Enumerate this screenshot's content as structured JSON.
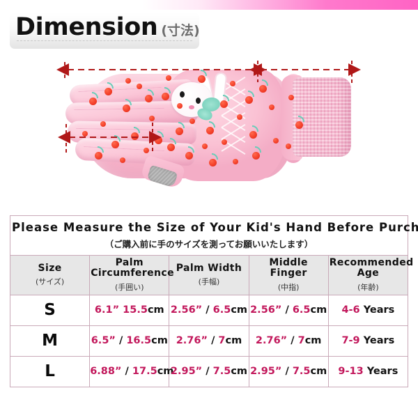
{
  "header": {
    "title_main": "Dimension",
    "title_sub": "(寸法)"
  },
  "photo": {
    "product_alt": "pink kids winter glove with cherry print and bunny applique",
    "measurements": [
      {
        "name": "palm-circumference-arrow",
        "label": ""
      },
      {
        "name": "cuff-length-arrow",
        "label": ""
      },
      {
        "name": "palm-width-arrow",
        "label": ""
      }
    ],
    "colors": {
      "glove_pink": "#fbc7d8",
      "cherry_red": "#f4402a",
      "stem_mint": "#67cdb8",
      "arrow_red": "#b01818",
      "thumb_gray": "#b3b3b3"
    }
  },
  "table": {
    "title_en": "Please Measure the Size of Your Kid's Hand Before Purchase",
    "title_jp": "（ご購入前に手のサイズを測ってお願いいたします）",
    "columns": [
      {
        "en": "Size",
        "jp": "(サイズ)"
      },
      {
        "en": "Palm Circumference",
        "jp": "(手囲い)"
      },
      {
        "en": "Palm Width",
        "jp": "(手幅)"
      },
      {
        "en": "Middle Finger",
        "jp": "(中指)"
      },
      {
        "en": "Recommended Age",
        "jp": "(年齢)"
      }
    ],
    "rows": [
      {
        "size": "S",
        "palm_circumference": {
          "inch": "6.1”",
          "sep": " ",
          "cm_value": "15.5",
          "cm_unit": "cm"
        },
        "palm_width": {
          "inch": "2.56”",
          "sep": " / ",
          "cm_value": "6.5",
          "cm_unit": "cm"
        },
        "middle_finger": {
          "inch": "2.56”",
          "sep": " / ",
          "cm_value": "6.5",
          "cm_unit": "cm"
        },
        "age": {
          "value": "4-6",
          "unit": " Years"
        }
      },
      {
        "size": "M",
        "palm_circumference": {
          "inch": "6.5”",
          "sep": " / ",
          "cm_value": "16.5",
          "cm_unit": "cm"
        },
        "palm_width": {
          "inch": "2.76”",
          "sep": " / ",
          "cm_value": "7",
          "cm_unit": "cm"
        },
        "middle_finger": {
          "inch": "2.76”",
          "sep": " / ",
          "cm_value": "7",
          "cm_unit": "cm"
        },
        "age": {
          "value": "7-9",
          "unit": " Years"
        }
      },
      {
        "size": "L",
        "palm_circumference": {
          "inch": "6.88”",
          "sep": " / ",
          "cm_value": "17.5",
          "cm_unit": "cm"
        },
        "palm_width": {
          "inch": "2.95”",
          "sep": " / ",
          "cm_value": "7.5",
          "cm_unit": "cm"
        },
        "middle_finger": {
          "inch": "2.95”",
          "sep": " / ",
          "cm_value": "7.5",
          "cm_unit": "cm"
        },
        "age": {
          "value": "9-13",
          "unit": " Years"
        }
      }
    ]
  },
  "theme": {
    "accent_pink": "#ff63c4",
    "table_border": "#c9a9b8",
    "header_bg": "#e7e7e7",
    "value_color": "#c2175b"
  }
}
